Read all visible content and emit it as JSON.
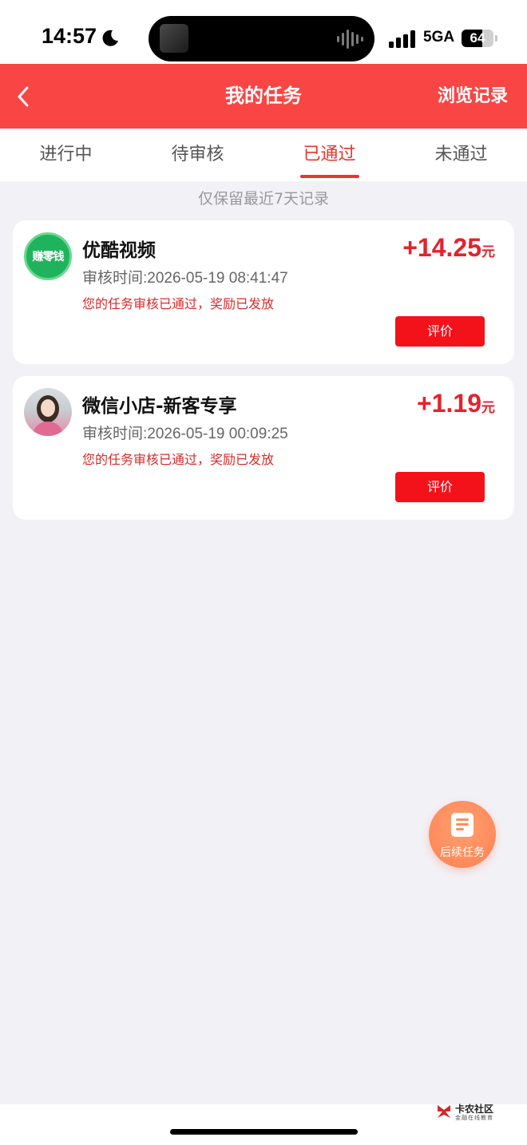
{
  "status_bar": {
    "time": "14:57",
    "network": "5GA",
    "battery": "64",
    "battery_level": 0.64
  },
  "header": {
    "title": "我的任务",
    "history_label": "浏览记录"
  },
  "tabs": [
    {
      "label": "进行中",
      "active": false
    },
    {
      "label": "待审核",
      "active": false
    },
    {
      "label": "已通过",
      "active": true
    },
    {
      "label": "未通过",
      "active": false
    }
  ],
  "notice": "仅保留最近7天记录",
  "tasks": [
    {
      "title": "优酷视频",
      "avatar_text": "赚零钱",
      "review_time": "审核时间:2026-05-19 08:41:47",
      "status": "您的任务审核已通过，奖励已发放",
      "amount": "+14.25",
      "unit": "元",
      "button": "评价"
    },
    {
      "title": "微信小店-新客专享",
      "review_time": "审核时间:2026-05-19 00:09:25",
      "status": "您的任务审核已通过，奖励已发放",
      "amount": "+1.19",
      "unit": "元",
      "button": "评价"
    }
  ],
  "float_button": {
    "label": "后续任务"
  },
  "watermark": {
    "title": "卡农社区",
    "subtitle": "金融在线教育"
  },
  "colors": {
    "header": "#fa4545",
    "accent": "#e5372e",
    "amount": "#e3232b",
    "button": "#f3121a",
    "float": "#ff8d5e",
    "background": "#f2f1f6"
  }
}
